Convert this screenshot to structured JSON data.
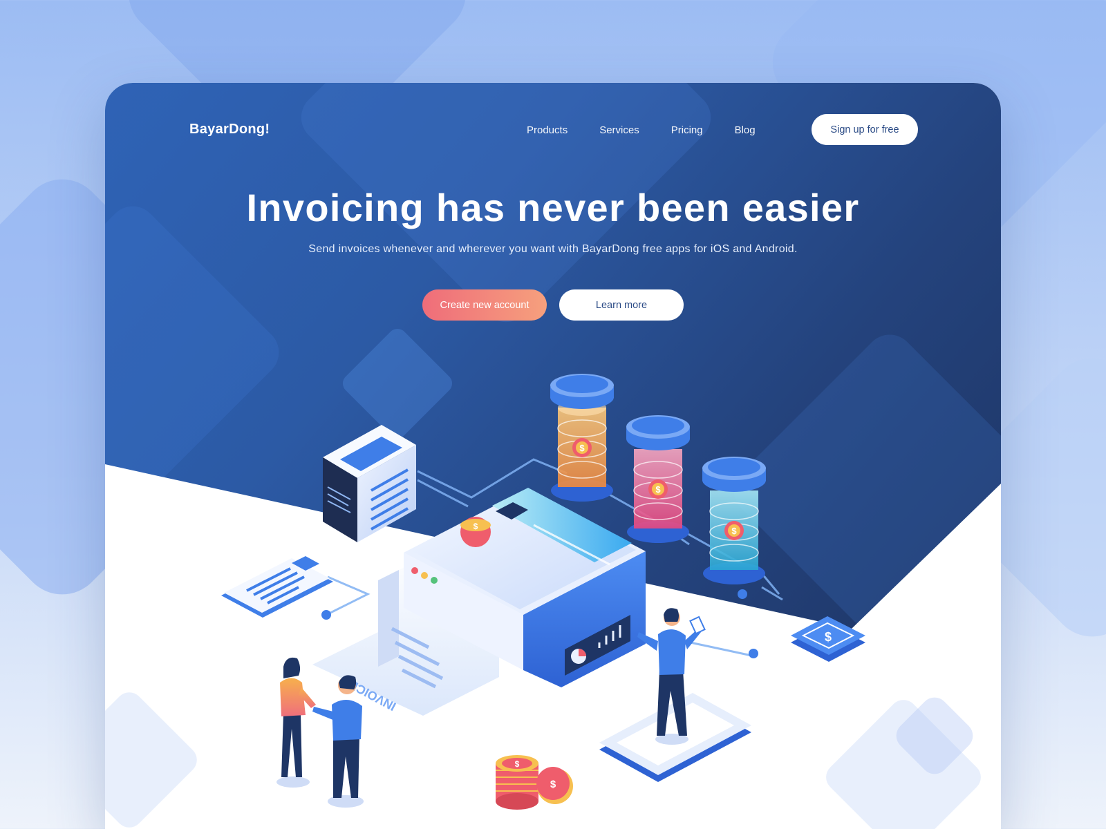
{
  "brand": {
    "name": "BayarDong!"
  },
  "nav": {
    "links": [
      "Products",
      "Services",
      "Pricing",
      "Blog"
    ],
    "signup_label": "Sign up for free"
  },
  "hero": {
    "title": "Invoicing has never been easier",
    "subtitle": "Send invoices whenever and wherever you want with BayarDong free apps for iOS and Android.",
    "primary_cta": "Create new account",
    "secondary_cta": "Learn more"
  },
  "illustration": {
    "receipt_text": "INVOICE",
    "coin_symbol": "$",
    "tube_colors": [
      "#f6a04a",
      "#ee5f8f",
      "#38b8d8"
    ]
  },
  "colors": {
    "accent_gradient": [
      "#ef6d7a",
      "#f6a07d"
    ],
    "hero_dark": "#1e3565",
    "hero_light": "#2f63b6"
  }
}
